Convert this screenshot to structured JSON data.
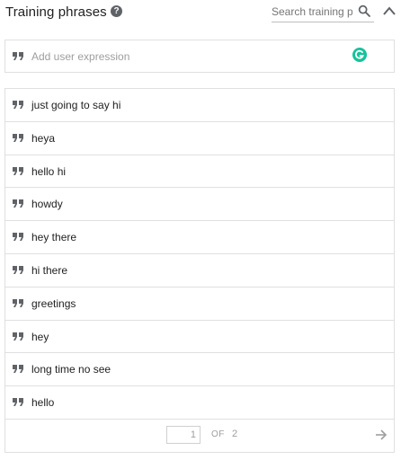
{
  "header": {
    "title": "Training phrases",
    "help_icon": "help-circle-icon",
    "search_placeholder": "Search training ph",
    "search_icon": "search-icon",
    "collapse_icon": "chevron-up-icon"
  },
  "entry": {
    "placeholder": "Add user expression",
    "quote_icon": "quote-icon",
    "extension_icon": "grammarly-icon"
  },
  "phrases": [
    "just going to say hi",
    "heya",
    "hello hi",
    "howdy",
    "hey there",
    "hi there",
    "greetings",
    "hey",
    "long time no see",
    "hello"
  ],
  "pagination": {
    "current_page": "1",
    "of_label": "OF",
    "total_pages": "2",
    "next_icon": "arrow-right-icon"
  },
  "colors": {
    "border": "#e0e0e0",
    "icon": "#5f6368",
    "muted_text": "#9e9e9e",
    "grammarly": "#15c39a"
  }
}
